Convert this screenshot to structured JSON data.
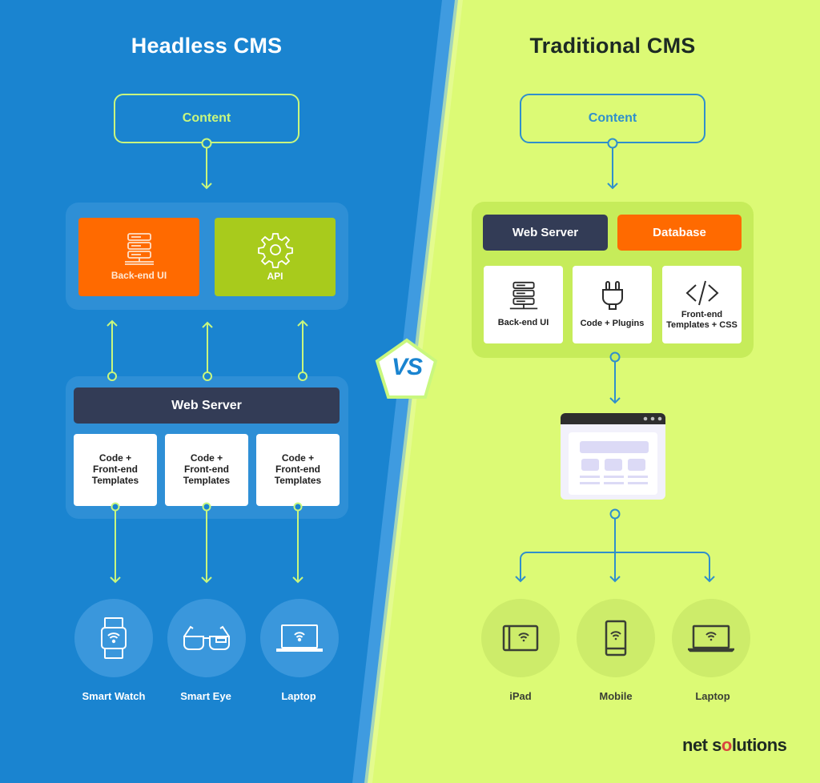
{
  "colors": {
    "headless_bg": "#1a84d0",
    "traditional_bg": "#dcfa75",
    "accent_green": "#c9f77e",
    "accent_blue": "#2f8fcc",
    "orange": "#ff6a00",
    "lime": "#a8cb1c",
    "navy": "#333c56"
  },
  "headless": {
    "title": "Headless CMS",
    "content_label": "Content",
    "backend_ui_label": "Back-end UI",
    "api_label": "API",
    "web_server_label": "Web Server",
    "templates": [
      {
        "line1": "Code +",
        "line2": "Front-end",
        "line3": "Templates"
      },
      {
        "line1": "Code +",
        "line2": "Front-end",
        "line3": "Templates"
      },
      {
        "line1": "Code +",
        "line2": "Front-end",
        "line3": "Templates"
      }
    ],
    "devices": [
      {
        "label": "Smart Watch",
        "icon": "smartwatch-icon"
      },
      {
        "label": "Smart Eye",
        "icon": "smart-glasses-icon"
      },
      {
        "label": "Laptop",
        "icon": "laptop-icon"
      }
    ]
  },
  "vs_label": "VS",
  "traditional": {
    "title": "Traditional CMS",
    "content_label": "Content",
    "web_server_label": "Web Server",
    "database_label": "Database",
    "tiles": [
      {
        "line1": "Back-end UI",
        "line2": "",
        "icon": "server-icon"
      },
      {
        "line1": "Code + Plugins",
        "line2": "",
        "icon": "plug-icon"
      },
      {
        "line1": "Front-end",
        "line2": "Templates + CSS",
        "icon": "code-icon"
      }
    ],
    "devices": [
      {
        "label": "iPad",
        "icon": "tablet-icon"
      },
      {
        "label": "Mobile",
        "icon": "mobile-icon"
      },
      {
        "label": "Laptop",
        "icon": "laptop-icon"
      }
    ]
  },
  "logo": {
    "part1": "net s",
    "part2": "o",
    "part3": "lutions"
  }
}
